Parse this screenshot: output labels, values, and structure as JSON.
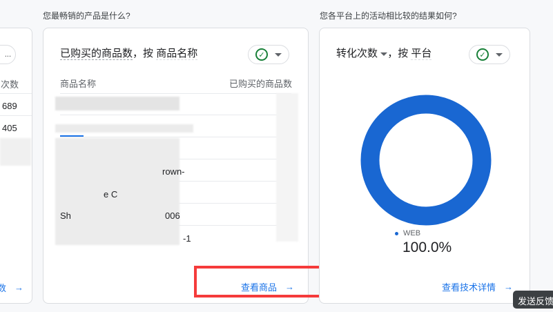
{
  "left_card": {
    "metric_header": "次数",
    "values": [
      "689",
      "405"
    ],
    "link_label": "数"
  },
  "products_card": {
    "question": "您最畅销的产品是什么?",
    "metric": "已购买的商品数",
    "separator": "，按",
    "dimension": "商品名称",
    "col_name": "商品名称",
    "col_value": "已购买的商品数",
    "visible_fragments": [
      "rown-",
      "e C",
      "Sh",
      "006",
      "-1"
    ],
    "link_label": "查看商品"
  },
  "platform_card": {
    "question": "您各平台上的活动相比较的结果如何?",
    "metric": "转化次数",
    "separator": "，按",
    "dimension": "平台",
    "legend_label": "WEB",
    "legend_value": "100.0%",
    "share": 1.0,
    "color": "#1967d2",
    "link_label": "查看技术详情"
  },
  "tooltip": "发送反馈"
}
